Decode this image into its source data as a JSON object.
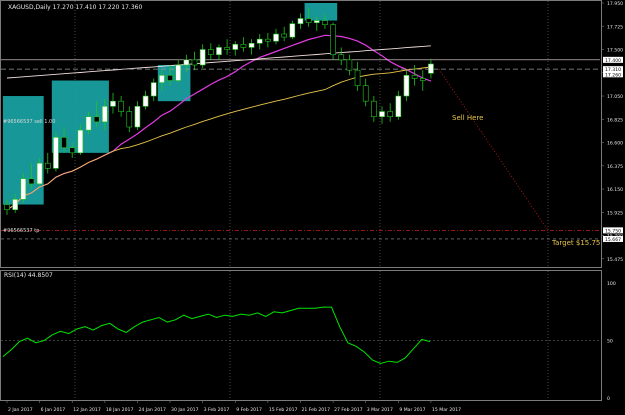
{
  "window": {
    "symbol_line": "XAGUSD,Daily  17.270 17.410 17.220 17.360",
    "rsi_label": "RSI(14) 44.8507"
  },
  "annotations": {
    "sell_here": "Sell Here",
    "target": "Target $15.75",
    "sell_order": "#96566537 sell 1.00",
    "tp_order": "#96566537 tp"
  },
  "colors": {
    "background": "#000000",
    "bull_body": "#ffffff",
    "bear_body": "#000000",
    "wick": "#22c522",
    "box": "#1aa7a7",
    "ma_magenta": "#e23ce2",
    "ma_yellow": "#e8c64a",
    "ma_white": "#f2dede",
    "rsi_line": "#00e600",
    "grid": "#7a7a7a",
    "sell_line": "#9a9a9a",
    "target_line": "#c81e1e",
    "axis_text": "#e6e6e6"
  },
  "chart_data": [
    {
      "type": "candlestick",
      "title": "XAGUSD,Daily  17.270 17.410 17.220 17.360",
      "ylim": [
        15.415,
        17.95
      ],
      "y_ticks": [
        "17.950",
        "17.725",
        "17.500",
        "17.275",
        "17.050",
        "16.825",
        "16.600",
        "16.375",
        "16.150",
        "15.925",
        "15.700",
        "15.475"
      ],
      "y_tick_values": [
        17.95,
        17.725,
        17.5,
        17.275,
        17.05,
        16.825,
        16.6,
        16.375,
        16.15,
        15.925,
        15.7,
        15.475
      ],
      "price_tags": [
        {
          "label": "17.400",
          "value": 17.4
        },
        {
          "label": "17.310",
          "value": 17.31
        },
        {
          "label": "17.260",
          "value": 17.26
        },
        {
          "label": "15.750",
          "value": 15.75
        },
        {
          "label": "15.667",
          "value": 15.667
        }
      ],
      "x_labels": [
        "2 Jan 2017",
        "6 Jan 2017",
        "12 Jan 2017",
        "18 Jan 2017",
        "24 Jan 2017",
        "30 Jan 2017",
        "3 Feb 2017",
        "9 Feb 2017",
        "15 Feb 2017",
        "21 Feb 2017",
        "27 Feb 2017",
        "3 Mar 2017",
        "9 Mar 2017",
        "15 Mar 2017"
      ],
      "x_label_index": [
        0,
        4,
        8,
        12,
        16,
        20,
        24,
        28,
        32,
        36,
        40,
        44,
        48,
        52
      ],
      "candles": [
        [
          16.0,
          16.05,
          15.9,
          15.95
        ],
        [
          15.95,
          16.1,
          15.92,
          16.05
        ],
        [
          16.05,
          16.3,
          16.02,
          16.25
        ],
        [
          16.25,
          16.4,
          16.15,
          16.2
        ],
        [
          16.2,
          16.45,
          16.18,
          16.4
        ],
        [
          16.4,
          16.5,
          16.3,
          16.35
        ],
        [
          16.35,
          16.7,
          16.32,
          16.65
        ],
        [
          16.65,
          16.75,
          16.5,
          16.55
        ],
        [
          16.55,
          16.6,
          16.45,
          16.5
        ],
        [
          16.5,
          16.78,
          16.48,
          16.72
        ],
        [
          16.72,
          16.9,
          16.68,
          16.85
        ],
        [
          16.85,
          17.0,
          16.75,
          16.8
        ],
        [
          16.8,
          17.02,
          16.72,
          16.95
        ],
        [
          16.95,
          17.08,
          16.88,
          17.0
        ],
        [
          17.0,
          17.05,
          16.85,
          16.9
        ],
        [
          16.9,
          16.95,
          16.7,
          16.75
        ],
        [
          16.75,
          17.0,
          16.72,
          16.95
        ],
        [
          16.95,
          17.1,
          16.92,
          17.05
        ],
        [
          17.05,
          17.22,
          17.0,
          17.18
        ],
        [
          17.18,
          17.3,
          17.1,
          17.25
        ],
        [
          17.25,
          17.35,
          17.15,
          17.2
        ],
        [
          17.2,
          17.4,
          17.18,
          17.35
        ],
        [
          17.35,
          17.45,
          17.28,
          17.4
        ],
        [
          17.4,
          17.48,
          17.3,
          17.35
        ],
        [
          17.35,
          17.55,
          17.32,
          17.5
        ],
        [
          17.5,
          17.56,
          17.4,
          17.45
        ],
        [
          17.45,
          17.55,
          17.4,
          17.52
        ],
        [
          17.52,
          17.6,
          17.45,
          17.5
        ],
        [
          17.5,
          17.58,
          17.44,
          17.55
        ],
        [
          17.55,
          17.62,
          17.48,
          17.52
        ],
        [
          17.52,
          17.6,
          17.45,
          17.56
        ],
        [
          17.56,
          17.65,
          17.5,
          17.6
        ],
        [
          17.6,
          17.66,
          17.52,
          17.58
        ],
        [
          17.58,
          17.7,
          17.55,
          17.65
        ],
        [
          17.65,
          17.72,
          17.58,
          17.62
        ],
        [
          17.62,
          17.78,
          17.6,
          17.75
        ],
        [
          17.75,
          17.85,
          17.7,
          17.8
        ],
        [
          17.8,
          17.9,
          17.72,
          17.76
        ],
        [
          17.76,
          17.82,
          17.68,
          17.78
        ],
        [
          17.78,
          17.84,
          17.7,
          17.74
        ],
        [
          17.74,
          17.76,
          17.4,
          17.45
        ],
        [
          17.45,
          17.52,
          17.35,
          17.4
        ],
        [
          17.4,
          17.45,
          17.25,
          17.3
        ],
        [
          17.3,
          17.38,
          17.1,
          17.15
        ],
        [
          17.15,
          17.22,
          16.95,
          17.0
        ],
        [
          17.0,
          17.05,
          16.8,
          16.85
        ],
        [
          16.85,
          16.95,
          16.78,
          16.9
        ],
        [
          16.9,
          16.98,
          16.8,
          16.85
        ],
        [
          16.85,
          17.1,
          16.82,
          17.05
        ],
        [
          17.05,
          17.3,
          17.0,
          17.25
        ],
        [
          17.25,
          17.35,
          17.15,
          17.22
        ],
        [
          17.22,
          17.3,
          17.1,
          17.2
        ],
        [
          17.27,
          17.41,
          17.22,
          17.36
        ]
      ]
    },
    {
      "type": "line",
      "title": "RSI(14) 44.8507",
      "ylim": [
        0,
        100
      ],
      "y_ticks": [
        "100",
        "50",
        "0"
      ],
      "y_tick_values": [
        100,
        50,
        0
      ],
      "values": [
        36,
        42,
        49,
        52,
        48,
        50,
        55,
        58,
        56,
        60,
        62,
        59,
        63,
        65,
        60,
        57,
        62,
        66,
        68,
        70,
        66,
        68,
        72,
        69,
        71,
        73,
        70,
        72,
        71,
        73,
        72,
        74,
        71,
        75,
        74,
        76,
        78,
        78,
        78,
        79,
        79,
        62,
        48,
        45,
        40,
        33,
        30,
        32,
        31,
        35,
        43,
        51,
        49
      ]
    }
  ]
}
